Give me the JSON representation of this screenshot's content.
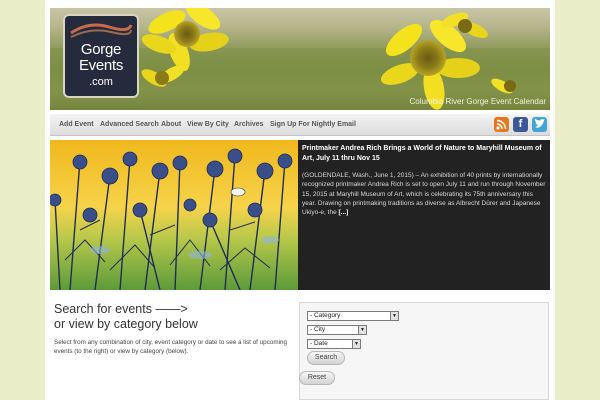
{
  "header": {
    "logo": {
      "line1": "Gorge",
      "line2": "Events",
      "line3": ".com"
    },
    "tagline": "Columbia River Gorge Event Calendar"
  },
  "nav": {
    "items": [
      {
        "label": "Add Event"
      },
      {
        "label": "Advanced Search"
      },
      {
        "label": "About"
      },
      {
        "label": "View By City"
      },
      {
        "label": "Archives"
      },
      {
        "label": "Sign Up For Nightly Email"
      }
    ],
    "social": [
      {
        "icon": "rss-icon",
        "glyph": "",
        "color": "#e8781e"
      },
      {
        "icon": "facebook-icon",
        "glyph": "f",
        "color": "#3b5998"
      },
      {
        "icon": "twitter-icon",
        "glyph": "",
        "color": "#3fa4d8"
      }
    ]
  },
  "feature": {
    "title": "Printmaker Andrea Rich Brings a World of Nature to Maryhill Museum of Art, July 11 thru Nov 15",
    "body": "(GOLDENDALE, Wash., June 1, 2015) – An exhibition of 40 prints by internationally recognized printmaker Andrea Rich is set to open July 11 and run through November 15, 2015 at Maryhill Museum of Art, which is celebrating its 75th anniversary this year. Drawing on printmaking traditions as diverse as Albrecht Dürer and Japanese Ukiyo-e, the",
    "more": "[...]"
  },
  "search": {
    "heading_line1": "Search for events ——>",
    "heading_line2": "or view by category below",
    "description": "Select from any combination of city, event category or date to see a list of upcoming events (to the right) or view by category (below).",
    "category_value": "- Category",
    "city_value": "- City",
    "date_value": "- Date",
    "search_label": "Search",
    "reset_label": "Reset"
  },
  "colors": {
    "background": "#e9eec8",
    "logo_bg": "#252a3c",
    "feature_bg": "#222222"
  }
}
